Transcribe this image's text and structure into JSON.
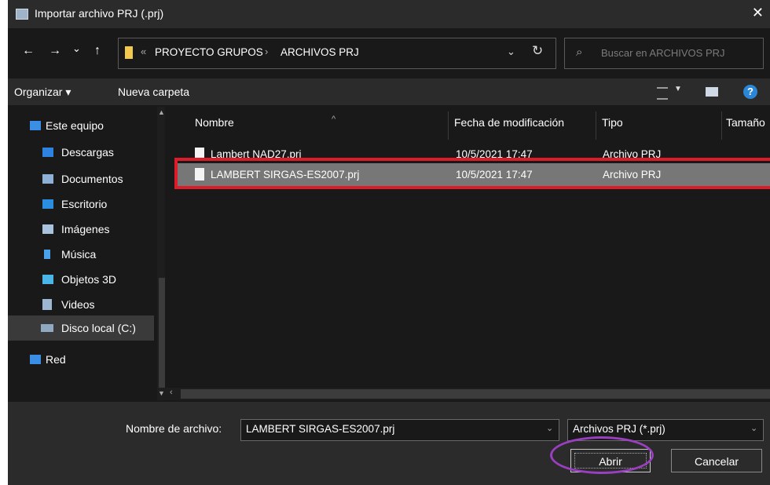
{
  "window": {
    "title": "Importar archivo PRJ (.prj)",
    "close_glyph": "✕"
  },
  "nav_buttons": {
    "back": "←",
    "forward": "→",
    "recent": "⌄",
    "up": "↑"
  },
  "address": {
    "overflow_chevron": "«",
    "crumbs": [
      "PROYECTO GRUPOS",
      "ARCHIVOS PRJ"
    ],
    "separator": "›",
    "dropdown_glyph": "⌄",
    "refresh_glyph": "↻"
  },
  "search": {
    "placeholder": "Buscar en ARCHIVOS PRJ",
    "icon": "search-icon"
  },
  "toolbar": {
    "organize": "Organizar ▾",
    "new_folder": "Nueva carpeta",
    "help": "?",
    "view_dropdown": "▼"
  },
  "sidebar": {
    "items": [
      {
        "label": "Este equipo",
        "icon": "computer-icon",
        "color": "#3a8ee6"
      },
      {
        "label": "Descargas",
        "icon": "download-icon",
        "color": "#2f83e0"
      },
      {
        "label": "Documentos",
        "icon": "documents-icon",
        "color": "#8fb0d6"
      },
      {
        "label": "Escritorio",
        "icon": "desktop-icon",
        "color": "#2a8de0"
      },
      {
        "label": "Imágenes",
        "icon": "pictures-icon",
        "color": "#a9c3de"
      },
      {
        "label": "Música",
        "icon": "music-icon",
        "color": "#4aa3ea"
      },
      {
        "label": "Objetos 3D",
        "icon": "objects3d-icon",
        "color": "#4ab6e8"
      },
      {
        "label": "Videos",
        "icon": "videos-icon",
        "color": "#9db7d0"
      },
      {
        "label": "Disco local (C:)",
        "icon": "drive-icon",
        "color": "#8fa9c2"
      },
      {
        "label": "Red",
        "icon": "network-icon",
        "color": "#3a8ee6"
      }
    ],
    "selected_index": 8
  },
  "columns": [
    "Nombre",
    "Fecha de modificación",
    "Tipo",
    "Tamaño"
  ],
  "files": [
    {
      "name": "Lambert NAD27.prj",
      "date": "10/5/2021 17:47",
      "type": "Archivo PRJ"
    },
    {
      "name": "LAMBERT SIRGAS-ES2007.prj",
      "date": "10/5/2021 17:47",
      "type": "Archivo PRJ"
    }
  ],
  "selected_file_index": 1,
  "footer": {
    "filename_label": "Nombre de archivo:",
    "filename_value": "LAMBERT SIRGAS-ES2007.prj",
    "filetype_value": "Archivos PRJ (*.prj)",
    "open_label": "Abrir",
    "cancel_label": "Cancelar"
  },
  "annotation_colors": {
    "selection_box": "#dc1c28",
    "open_button_ellipse": "#9a3fc0"
  }
}
